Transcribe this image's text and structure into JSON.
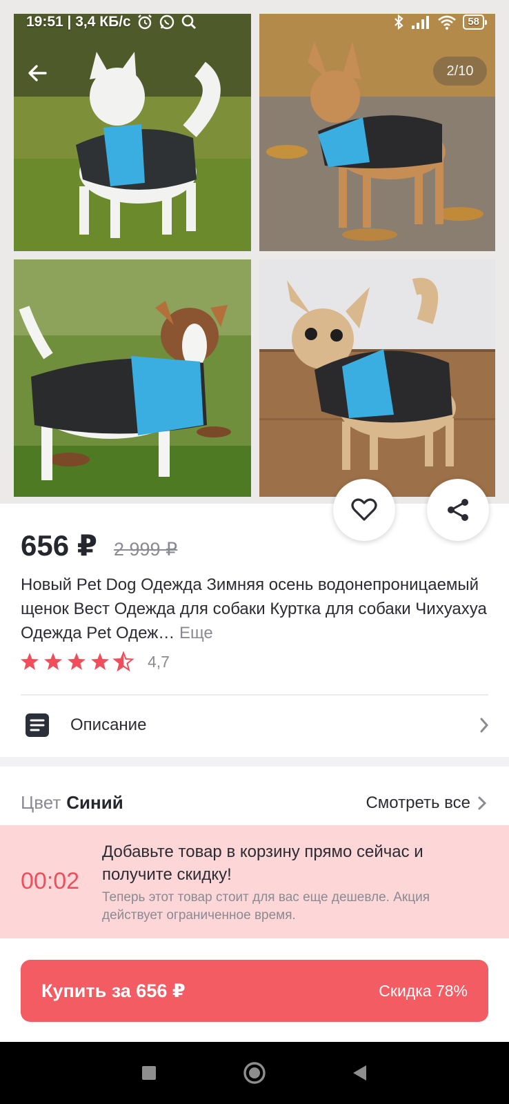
{
  "status_bar": {
    "time_speed": "19:51 | 3,4 КБ/с",
    "battery": "58"
  },
  "gallery": {
    "counter": "2/10"
  },
  "product": {
    "price": "656 ₽",
    "old_price": "2 999 ₽",
    "title": "Новый Pet Dog Одежда Зимняя осень водонепроницаемый щенок Вест Одежда для собаки Куртка для собаки Чихуахуа Одежда Pet Одеж…",
    "more_label": "Еще",
    "rating": "4,7",
    "rating_stars": 4.5
  },
  "description": {
    "label": "Описание"
  },
  "color": {
    "label": "Цвет",
    "value": "Синий",
    "see_all": "Смотреть все"
  },
  "promo": {
    "timer": "00:02",
    "title": "Добавьте товар в корзину прямо сейчас и получите скидку!",
    "subtitle": "Теперь этот товар стоит для вас еще дешевле. Акция действует ограниченное время."
  },
  "buy": {
    "label": "Купить за 656 ₽",
    "discount": "Скидка 78%"
  },
  "colors": {
    "accent": "#f45c63",
    "promo_bg": "#fdd6d8",
    "timer": "#ef4e5b",
    "star": "#ef4e5b"
  }
}
